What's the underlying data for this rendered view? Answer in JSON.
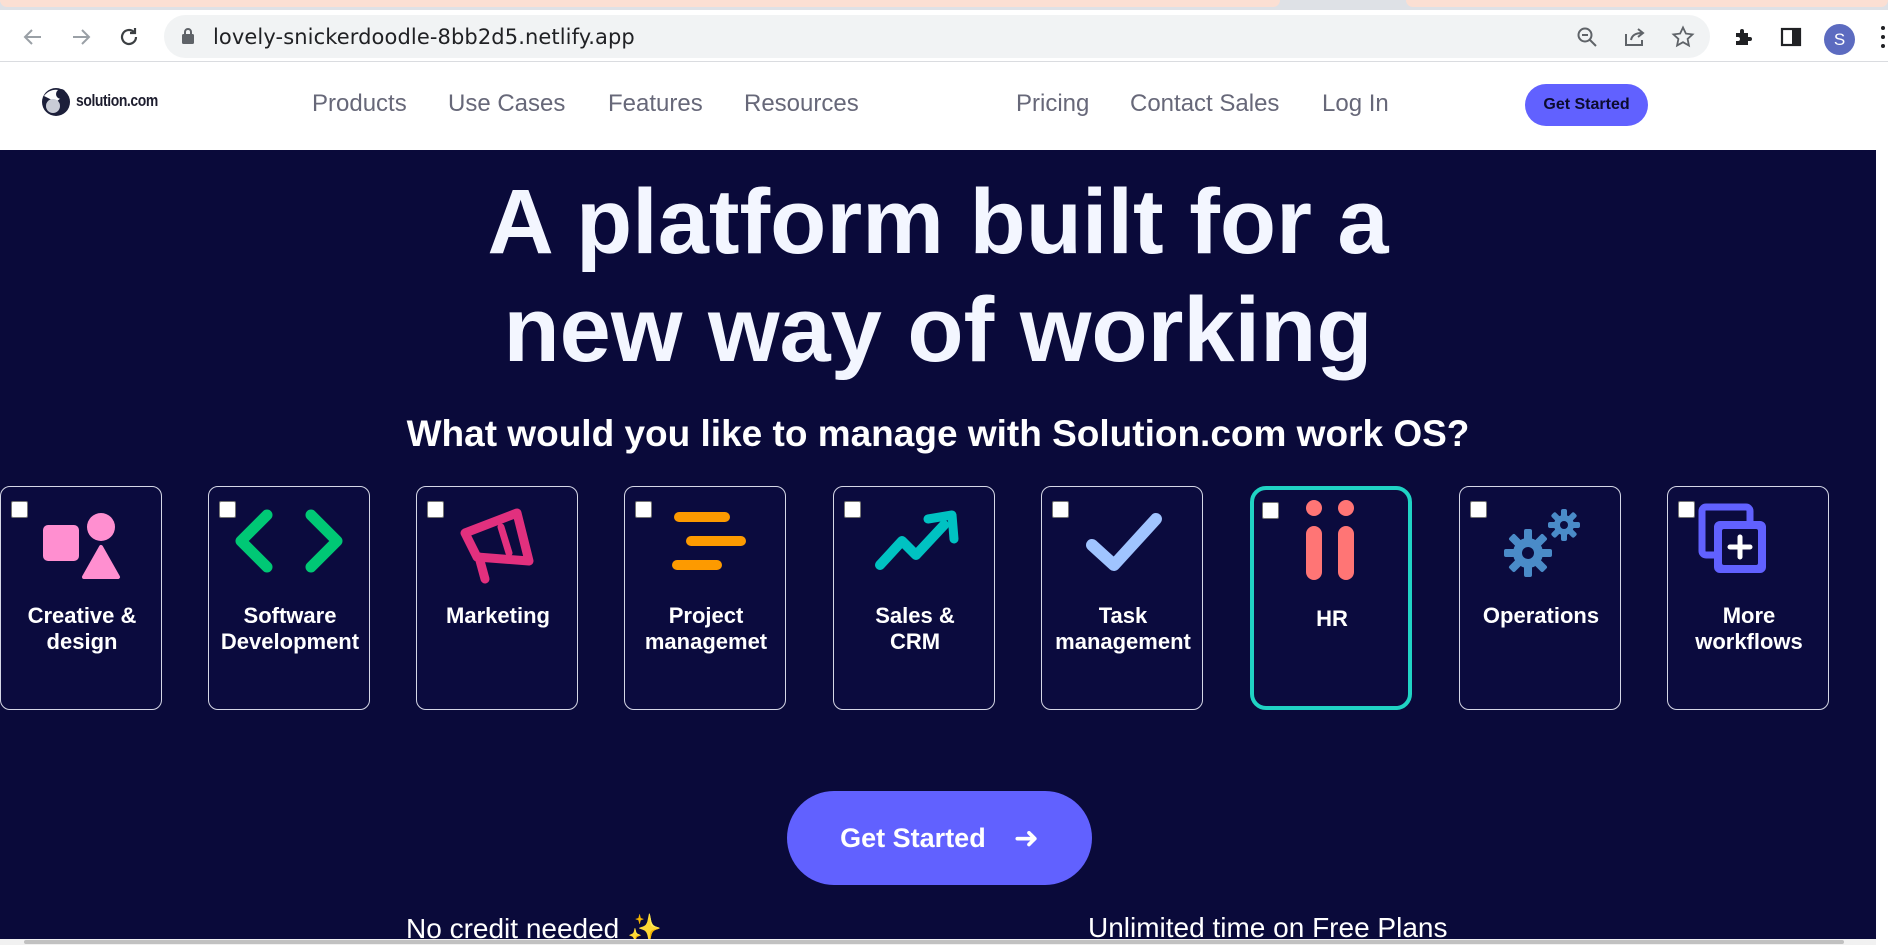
{
  "browser": {
    "url": "lovely-snickerdoodle-8bb2d5.netlify.app",
    "profile_initial": "S",
    "icons": [
      "back-icon",
      "forward-icon",
      "reload-icon",
      "lock-icon",
      "zoom-icon",
      "share-icon",
      "star-icon",
      "extensions-icon",
      "side-panel-icon",
      "menu-icon"
    ]
  },
  "site": {
    "logo_text": "solution.com",
    "nav": {
      "products": "Products",
      "use_cases": "Use Cases",
      "features": "Features",
      "resources": "Resources",
      "pricing": "Pricing",
      "contact_sales": "Contact Sales",
      "log_in": "Log In",
      "get_started": "Get Started"
    }
  },
  "hero": {
    "title_line1": "A platform built for a",
    "title_line2": "new way of working",
    "question": "What would you like to manage with Solution.com work OS?",
    "cards": [
      {
        "label": "Creative &\ndesign",
        "icon": "shapes-icon",
        "checked": false
      },
      {
        "label": "Software\nDevelopment",
        "icon": "code-brackets-icon",
        "checked": false
      },
      {
        "label": "Marketing",
        "icon": "megaphone-icon",
        "checked": false
      },
      {
        "label": "Project\nmanagemet",
        "icon": "bars-icon",
        "checked": false
      },
      {
        "label": "Sales &\nCRM",
        "icon": "trend-arrow-icon",
        "checked": false
      },
      {
        "label": "Task\nmanagement",
        "icon": "checkmark-icon",
        "checked": false
      },
      {
        "label": "HR",
        "icon": "people-icon",
        "checked": false,
        "highlighted": true
      },
      {
        "label": "Operations",
        "icon": "gears-icon",
        "checked": false
      },
      {
        "label": "More\nworkflows",
        "icon": "add-layers-icon",
        "checked": false
      }
    ],
    "cta_label": "Get Started",
    "cta_arrow": "➜",
    "perks": {
      "left": "No credit needed ✨",
      "right": "Unlimited time on Free Plans"
    }
  },
  "colors": {
    "hero_bg": "#0a0a3a",
    "accent": "#6161ff",
    "selected_border": "#20d3c4"
  }
}
